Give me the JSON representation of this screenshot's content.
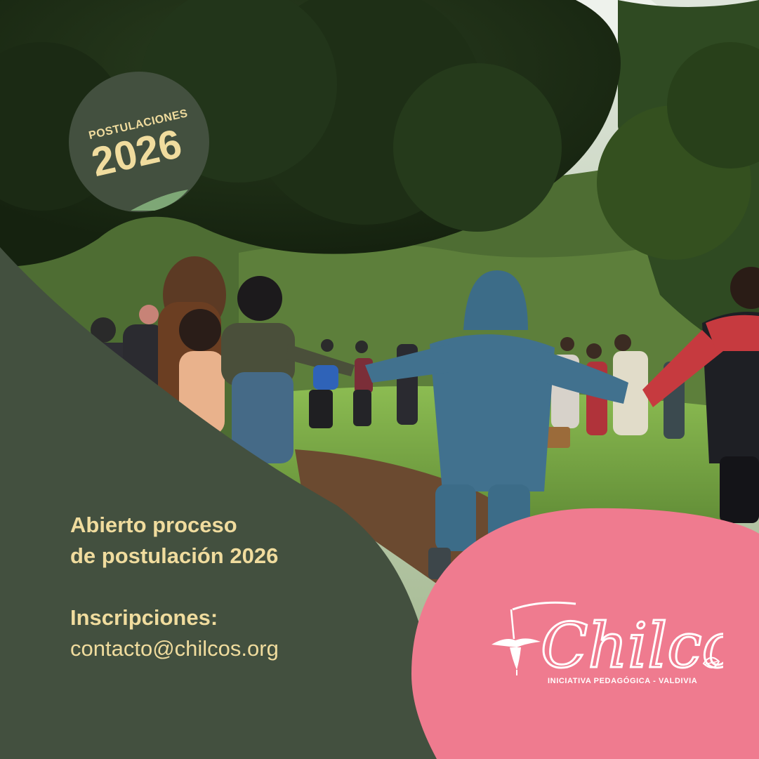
{
  "colors": {
    "dark_green": "#43503f",
    "cream": "#f0dc9e",
    "pink": "#ef7b8f",
    "white": "#ffffff",
    "sky": "#e6ebe4",
    "forest_dark": "#1f2e18",
    "forest_mid": "#3d5a2a",
    "grass": "#7fae4a",
    "leaf_litter": "#5a3e2a",
    "jacket_blue": "#3e6f8c",
    "jacket_red": "#c53a3e"
  },
  "badge": {
    "label": "POSTULACIONES",
    "year": "2026"
  },
  "announcement": {
    "line1": "Abierto proceso",
    "line2": "de postulación 2026",
    "inscriptions_label": "Inscripciones:",
    "email": "contacto@chilcos.org"
  },
  "logo": {
    "wordmark": "Chilcos",
    "tagline": "INICIATIVA PEDAGÓGICA - VALDIVIA",
    "icon": "fuchsia-flower-icon",
    "leaf_icon": "leaf-icon"
  }
}
